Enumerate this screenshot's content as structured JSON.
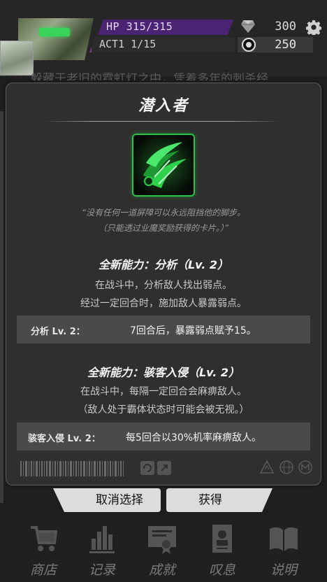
{
  "hud": {
    "hp": "HP 315/315",
    "act": "ACT1 1/15",
    "gems": "300",
    "coins": "250",
    "story_text": "躲藏于老旧的霓虹灯之中，凭着多年的刺杀经",
    "icons": {
      "gem": "diamond-icon",
      "coin": "coin-icon",
      "settings": "gear-icon"
    },
    "colors": {
      "hp_bar": "#4a2373",
      "accent_green": "#2fc04a"
    }
  },
  "card": {
    "title": "潜入者",
    "art_icon": "green-claw-slash-icon",
    "quote_line1": "“没有任何一道屏障可以永远阻挡他的脚步。",
    "quote_line2": "（只能透过业魔奖励获得的卡片。）”",
    "abilities": [
      {
        "heading": "全新能力：分析（Lv. 2）",
        "desc_line1": "在战斗中，分析敌人找出弱点。",
        "desc_line2": "经过一定回合时，施加敌人暴露弱点。",
        "level_label": "分析 Lv. 2：",
        "level_effect": "7回合后，暴露弱点赋予15。"
      },
      {
        "heading": "全新能力：骇客入侵（Lv. 2）",
        "desc_line1": "在战斗中，每隔一定回合会麻痹敌人。",
        "desc_line2": "（敌人处于霸体状态时可能会被无视。）",
        "level_label": "骇客入侵 Lv. 2：",
        "level_effect": "每5回合以30%机率麻痹敌人。"
      }
    ]
  },
  "buttons": {
    "cancel": "取消选择",
    "get": "获得"
  },
  "nav": [
    {
      "label": "商店",
      "icon": "shop-cart-icon"
    },
    {
      "label": "记录",
      "icon": "stats-bars-icon"
    },
    {
      "label": "成就",
      "icon": "certificate-icon"
    },
    {
      "label": "叹息",
      "icon": "tombstone-icon"
    },
    {
      "label": "说明",
      "icon": "book-icon"
    }
  ]
}
